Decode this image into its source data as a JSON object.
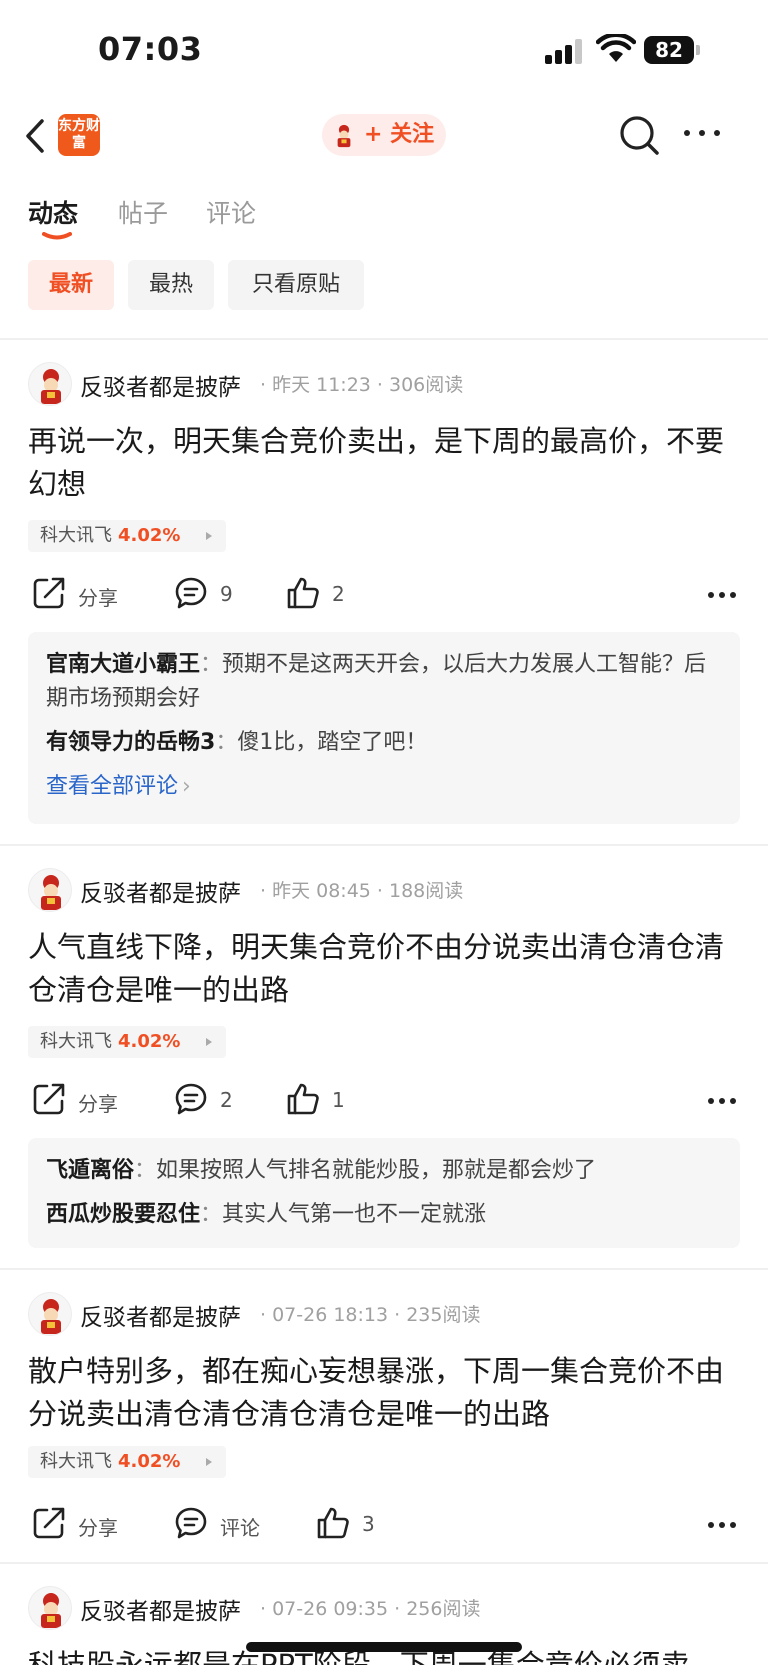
{
  "status_bar": {
    "time": "07:03",
    "battery": "82"
  },
  "nav": {
    "logo_text": "东方财富",
    "follow_label": "+ 关注"
  },
  "tabs": [
    {
      "label": "动态",
      "active": true
    },
    {
      "label": "帖子",
      "active": false
    },
    {
      "label": "评论",
      "active": false
    }
  ],
  "filters": [
    {
      "label": "最新",
      "active": true
    },
    {
      "label": "最热",
      "active": false
    },
    {
      "label": "只看原贴",
      "active": false
    }
  ],
  "accent_color": "#f04f24",
  "posts": [
    {
      "author": "反驳者都是披萨",
      "meta": "· 昨天 11:23 · 306阅读",
      "text": "再说一次，明天集合竞价卖出，是下周的最高价，不要幻想",
      "stock_name": "科大讯飞",
      "stock_change": "4.02%",
      "share_label": "分享",
      "comment_count": "9",
      "like_count": "2",
      "comments": [
        {
          "user": "官南大道小霸王",
          "sep": "：",
          "text": "预期不是这两天开会，以后大力发展人工智能？后期市场预期会好"
        },
        {
          "user": "有领导力的岳畅3",
          "sep": "：",
          "text": "傻1比，踏空了吧！"
        }
      ],
      "view_all": "查看全部评论"
    },
    {
      "author": "反驳者都是披萨",
      "meta": "· 昨天 08:45 · 188阅读",
      "text": "人气直线下降，明天集合竞价不由分说卖出清仓清仓清仓清仓是唯一的出路",
      "stock_name": "科大讯飞",
      "stock_change": "4.02%",
      "share_label": "分享",
      "comment_count": "2",
      "like_count": "1",
      "comments": [
        {
          "user": "飞遁离俗",
          "sep": "：",
          "text": "如果按照人气排名就能炒股，那就是都会炒了"
        },
        {
          "user": "西瓜炒股要忍住",
          "sep": "：",
          "text": "其实人气第一也不一定就涨"
        }
      ]
    },
    {
      "author": "反驳者都是披萨",
      "meta": "· 07-26 18:13 · 235阅读",
      "text": "散户特别多，都在痴心妄想暴涨，下周一集合竞价不由分说卖出清仓清仓清仓清仓是唯一的出路",
      "stock_name": "科大讯飞",
      "stock_change": "4.02%",
      "share_label": "分享",
      "comment_label": "评论",
      "like_count": "3"
    },
    {
      "author": "反驳者都是披萨",
      "meta": "· 07-26 09:35 · 256阅读",
      "text": "科技股永远都是在PPT阶段，下周一集合竞价必须卖"
    }
  ]
}
